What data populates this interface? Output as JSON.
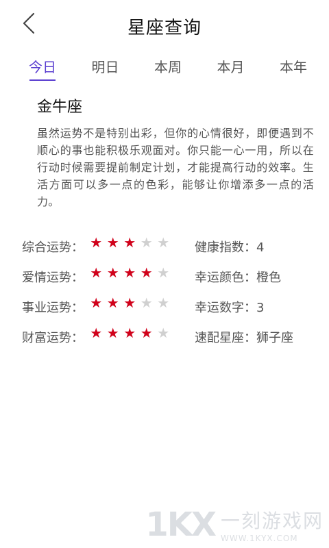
{
  "header": {
    "back_icon": "chevron-left-icon",
    "title": "星座查询"
  },
  "tabs": [
    {
      "label": "今日",
      "active": true
    },
    {
      "label": "明日",
      "active": false
    },
    {
      "label": "本周",
      "active": false
    },
    {
      "label": "本月",
      "active": false
    },
    {
      "label": "本年",
      "active": false
    }
  ],
  "sign": {
    "name": "金牛座",
    "description": "虽然运势不是特别出彩，但你的心情很好，即便遇到不顺心的事也能积极乐观面对。你只能一心一用，所以在行动时候需要提前制定计划，才能提高行动的效率。生活方面可以多一点的色彩，能够让你增添多一点的活力。"
  },
  "fortune": [
    {
      "label": "综合运势：",
      "rating": 3,
      "max": 5,
      "right_label": "健康指数：",
      "right_value": "4"
    },
    {
      "label": "爱情运势：",
      "rating": 4,
      "max": 5,
      "right_label": "幸运颜色：",
      "right_value": "橙色"
    },
    {
      "label": "事业运势：",
      "rating": 3,
      "max": 5,
      "right_label": "幸运数字：",
      "right_value": "3"
    },
    {
      "label": "财富运势：",
      "rating": 4,
      "max": 5,
      "right_label": "速配星座：",
      "right_value": "狮子座"
    }
  ],
  "colors": {
    "accent": "#5b3fd0",
    "star_on": "#d0021b",
    "star_off": "#d0d0d0"
  },
  "watermark": {
    "logo": "1KX",
    "text": "一刻游戏网",
    "url": "WWW.1KYX.COM"
  }
}
